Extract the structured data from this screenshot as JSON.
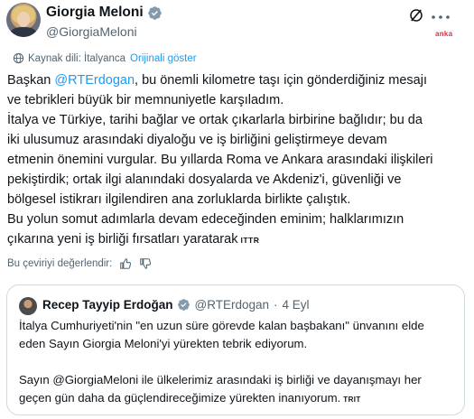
{
  "tweet": {
    "author_name": "Giorgia Meloni",
    "author_handle": "@GiorgiaMeloni",
    "watermark": "anka",
    "translation_label": "Kaynak dili: İtalyanca",
    "show_original_label": "Orijinali göster",
    "body_parts": [
      {
        "text": "Başkan ",
        "mention": false
      },
      {
        "text": "@RTErdogan",
        "mention": true
      },
      {
        "text": ", bu önemli kilometre taşı için gönderdiğiniz mesajı\nve tebrikleri büyük bir memnuniyetle karşıladım.\nİtalya ve Türkiye, tarihi bağlar ve ortak çıkarlarla birbirine bağlıdır; bu da\niki ulusumuz arasındaki diyaloğu ve iş birliğini geliştirmeye devam\netmenin önemini vurgular. Bu yıllarda Roma ve Ankara arasındaki ilişkileri\npekiştirdik; ortak ilgi alanındaki dosyalarda ve Akdeniz'i, güvenliği ve\nbölgesel istikrarı ilgilendiren ana zorluklarda birlikte çalıştık.\nBu yolun somut adımlarla devam edeceğinden eminim; halklarımızın\nçıkarına yeni iş birliği fırsatları yaratarak",
        "mention": false
      }
    ],
    "body_flag": "ITTR",
    "rate_label": "Bu çeviriyi değerlendir:",
    "icons": [
      "grok-icon",
      "more-icon",
      "globe-icon",
      "thumb-up-icon",
      "thumb-down-icon",
      "verified-badge-icon"
    ],
    "accent_color": "#1d9bf0"
  },
  "quote": {
    "author_name": "Recep Tayyip Erdoğan",
    "author_handle": "@RTErdogan",
    "dot": "·",
    "date": "4 Eyl",
    "text": "İtalya Cumhuriyeti'nin \"en uzun süre görevde kalan başbakanı\" ünvanını elde\neden Sayın Giorgia Meloni'yi yürekten tebrik ediyorum.\n\nSayın @GiorgiaMeloni ile ülkelerimiz arasındaki iş birliği ve dayanışmayı her\ngeçen gün daha da güçlendireceğimize yürekten inanıyorum.",
    "flag": "TRIT"
  }
}
